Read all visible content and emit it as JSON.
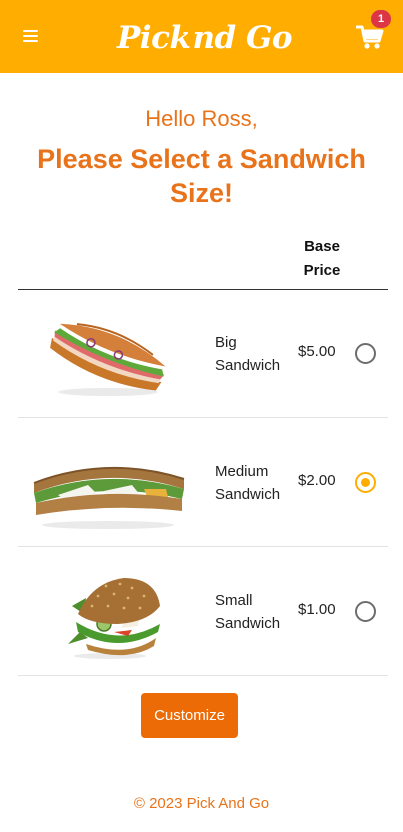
{
  "header": {
    "logo_left": "Pick",
    "logo_right": "nd Go",
    "cart_count": "1",
    "brand_color": "#ffad00"
  },
  "greeting": "Hello Ross,",
  "title": "Please Select a Sandwich Size!",
  "table": {
    "price_header_line1": "Base",
    "price_header_line2": "Price"
  },
  "sizes": [
    {
      "name_line1": "Big",
      "name_line2": "Sandwich",
      "price": "$5.00",
      "selected": false,
      "image": "sub-sandwich-image"
    },
    {
      "name_line1": "Medium",
      "name_line2": "Sandwich",
      "price": "$2.00",
      "selected": true,
      "image": "triangle-sandwich-image"
    },
    {
      "name_line1": "Small",
      "name_line2": "Sandwich",
      "price": "$1.00",
      "selected": false,
      "image": "burger-sandwich-image"
    }
  ],
  "customize_label": "Customize",
  "footer": "© 2023 Pick And Go",
  "accent_color": "#e8731a"
}
